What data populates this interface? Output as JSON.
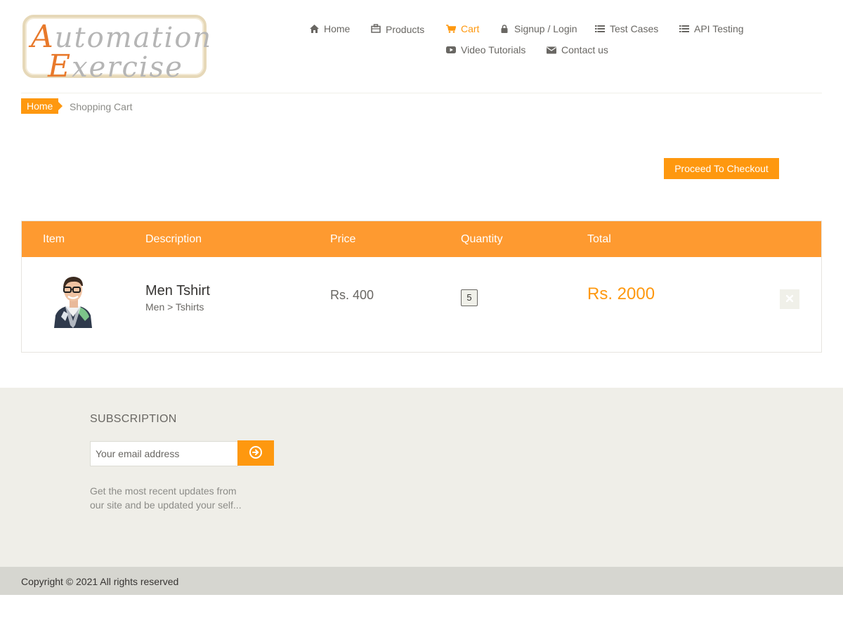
{
  "logo": {
    "line1_cap": "A",
    "line1_rest": "utomation",
    "line2_cap": "E",
    "line2_rest": "xercise"
  },
  "nav": {
    "items": [
      {
        "label": "Home",
        "icon": "home-icon"
      },
      {
        "label": "Products",
        "icon": "briefcase-icon"
      },
      {
        "label": "Cart",
        "icon": "shopping-cart-icon",
        "active": true
      },
      {
        "label": "Signup / Login",
        "icon": "lock-icon"
      },
      {
        "label": "Test Cases",
        "icon": "list-icon"
      },
      {
        "label": "API Testing",
        "icon": "list-icon"
      },
      {
        "label": "Video Tutorials",
        "icon": "youtube-play-icon"
      },
      {
        "label": "Contact us",
        "icon": "envelope-icon"
      }
    ]
  },
  "breadcrumb": {
    "home": "Home",
    "current": "Shopping Cart"
  },
  "checkout": {
    "label": "Proceed To Checkout"
  },
  "cart": {
    "columns": [
      "Item",
      "Description",
      "Price",
      "Quantity",
      "Total"
    ],
    "rows": [
      {
        "name": "Men Tshirt",
        "category": "Men > Tshirts",
        "price": "Rs. 400",
        "quantity": "5",
        "total": "Rs. 2000"
      }
    ]
  },
  "subscription": {
    "title": "SUBSCRIPTION",
    "placeholder": "Your email address",
    "description": "Get the most recent updates from our site and be updated your self..."
  },
  "footer": {
    "copyright": "Copyright © 2021 All rights reserved"
  },
  "colors": {
    "accent": "#FE980F",
    "footer_bg": "#EFEEE8",
    "text": "#696763"
  }
}
